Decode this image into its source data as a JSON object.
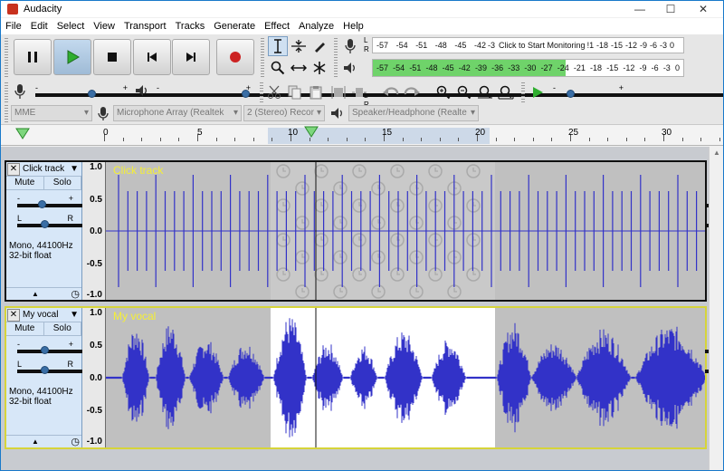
{
  "window": {
    "title": "Audacity",
    "minimize": "—",
    "maximize": "☐",
    "close": "✕"
  },
  "menu": [
    "File",
    "Edit",
    "Select",
    "View",
    "Transport",
    "Tracks",
    "Generate",
    "Effect",
    "Analyze",
    "Help"
  ],
  "meters": {
    "record_scale": [
      "-57",
      "-54",
      "-51",
      "-48",
      "-45",
      "-42",
      "-3"
    ],
    "record_hint": "Click to Start Monitoring",
    "record_scale_right": [
      "!1",
      "-18",
      "-15",
      "-12",
      "-9",
      "-6",
      "-3",
      "0"
    ],
    "play_scale": [
      "-57",
      "-54",
      "-51",
      "-48",
      "-45",
      "-42",
      "-39",
      "-36",
      "-33",
      "-30",
      "-27",
      "-24",
      "-21",
      "-18",
      "-15",
      "-12",
      "-9",
      "-6",
      "-3",
      "0"
    ],
    "play_level": 0.62,
    "L": "L",
    "R": "R"
  },
  "mixer": {
    "plus": "+",
    "minus": "-",
    "record_volume": 0.62,
    "playback_volume": 0.95
  },
  "play_speed": 0.25,
  "devices": {
    "host": "MME",
    "recording_device": "Microphone Array (Realtek",
    "channels": "2 (Stereo) Recor",
    "playback_device": "Speaker/Headphone (Realte"
  },
  "ruler": {
    "labels": [
      "0",
      "5",
      "10",
      "15",
      "20",
      "25",
      "30"
    ]
  },
  "tracks": [
    {
      "name": "Click track",
      "title": "Click track",
      "mute": "Mute",
      "solo": "Solo",
      "format1": "Mono, 44100Hz",
      "format2": "32-bit float",
      "gain": 0.45,
      "pan": 0.5
    },
    {
      "name": "My vocal",
      "title": "My vocal",
      "mute": "Mute",
      "solo": "Solo",
      "format1": "Mono, 44100Hz",
      "format2": "32-bit float",
      "gain": 0.5,
      "pan": 0.5
    }
  ],
  "scale": [
    "1.0",
    "0.5",
    "0.0",
    "-0.5",
    "-1.0"
  ],
  "colors": {
    "waveform": "#3232c8",
    "selection": "#ffffff",
    "track_label": "#f5ef35",
    "focus": "#d6d43a",
    "meter_green": "#6fd36a"
  }
}
